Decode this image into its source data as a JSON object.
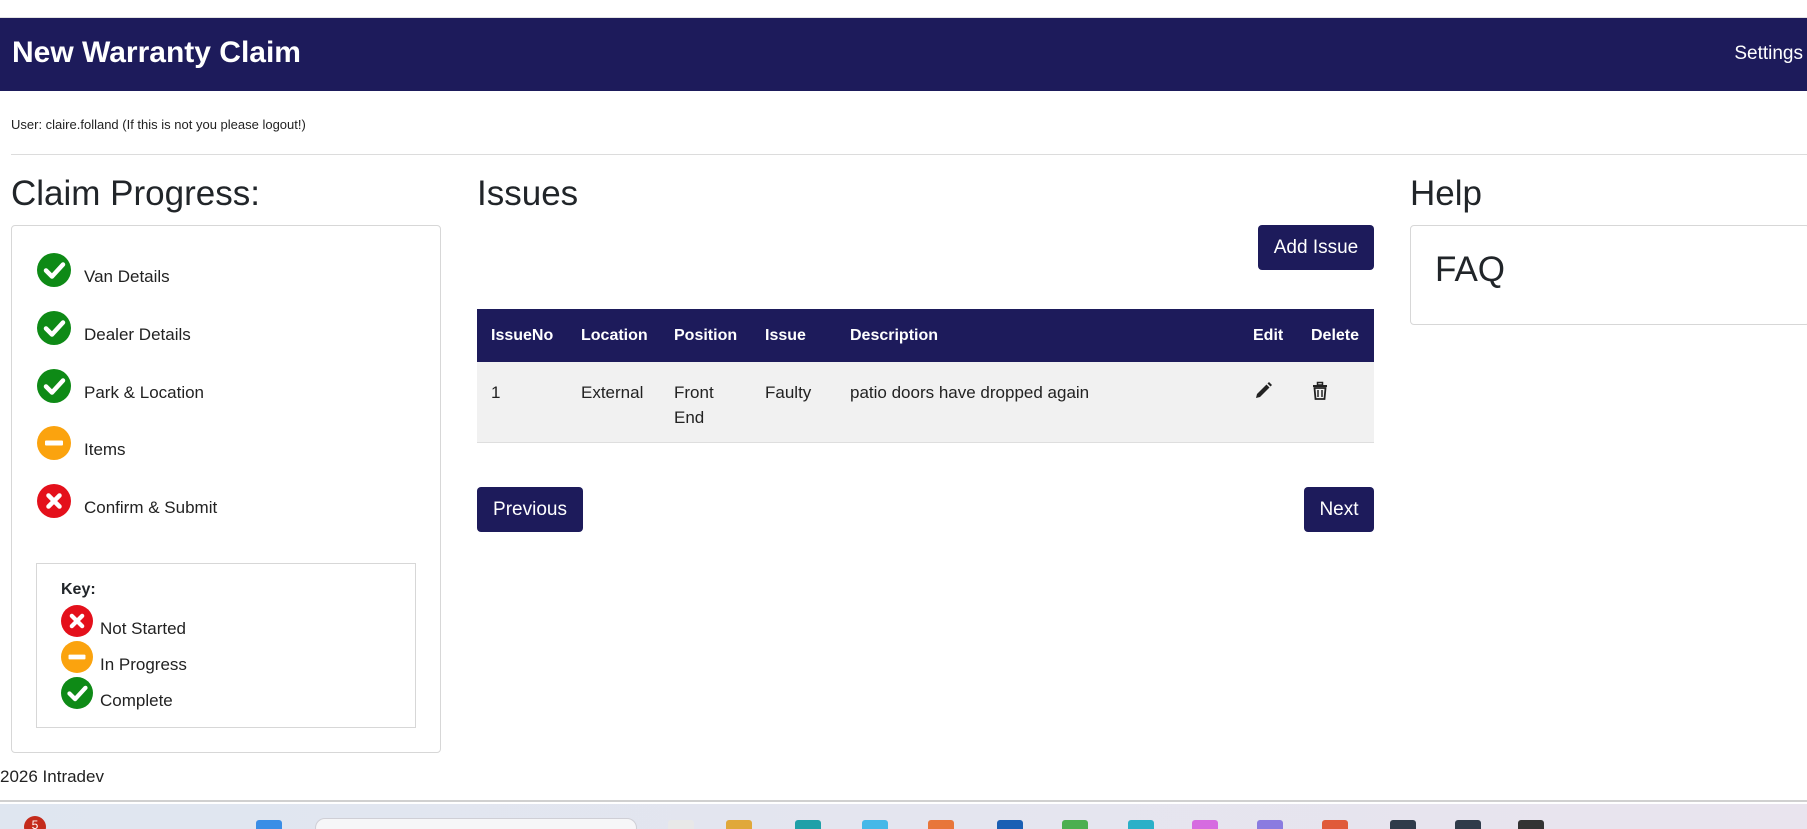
{
  "header": {
    "title": "New Warranty Claim",
    "settings_label": "Settings"
  },
  "user_line": "User: claire.folland (If this is not you please logout!)",
  "progress": {
    "heading": "Claim Progress:",
    "steps": [
      {
        "label": "Van Details",
        "status": "complete"
      },
      {
        "label": "Dealer Details",
        "status": "complete"
      },
      {
        "label": "Park & Location",
        "status": "complete"
      },
      {
        "label": "Items",
        "status": "in-progress"
      },
      {
        "label": "Confirm & Submit",
        "status": "not-started"
      }
    ],
    "key": {
      "title": "Key:",
      "items": [
        {
          "label": "Not Started",
          "status": "not-started"
        },
        {
          "label": "In Progress",
          "status": "in-progress"
        },
        {
          "label": "Complete",
          "status": "complete"
        }
      ]
    }
  },
  "issues": {
    "heading": "Issues",
    "add_button": "Add Issue",
    "columns": [
      "IssueNo",
      "Location",
      "Position",
      "Issue",
      "Description",
      "Edit",
      "Delete"
    ],
    "rows": [
      {
        "issue_no": "1",
        "location": "External",
        "position_line1": "Front",
        "position_line2": "End",
        "issue": "Faulty",
        "description": "patio doors have dropped again",
        "edit_icon": "pencil-icon",
        "delete_icon": "trash-icon"
      }
    ],
    "previous_button": "Previous",
    "next_button": "Next"
  },
  "help": {
    "heading": "Help",
    "faq_label": "FAQ"
  },
  "footer": "2026 Intradev",
  "taskbar": {
    "notification_count": "5"
  },
  "colors": {
    "brand": "#1d1b5b",
    "complete": "#0e8a16",
    "in_progress": "#fba30e",
    "not_started": "#e4101b"
  }
}
